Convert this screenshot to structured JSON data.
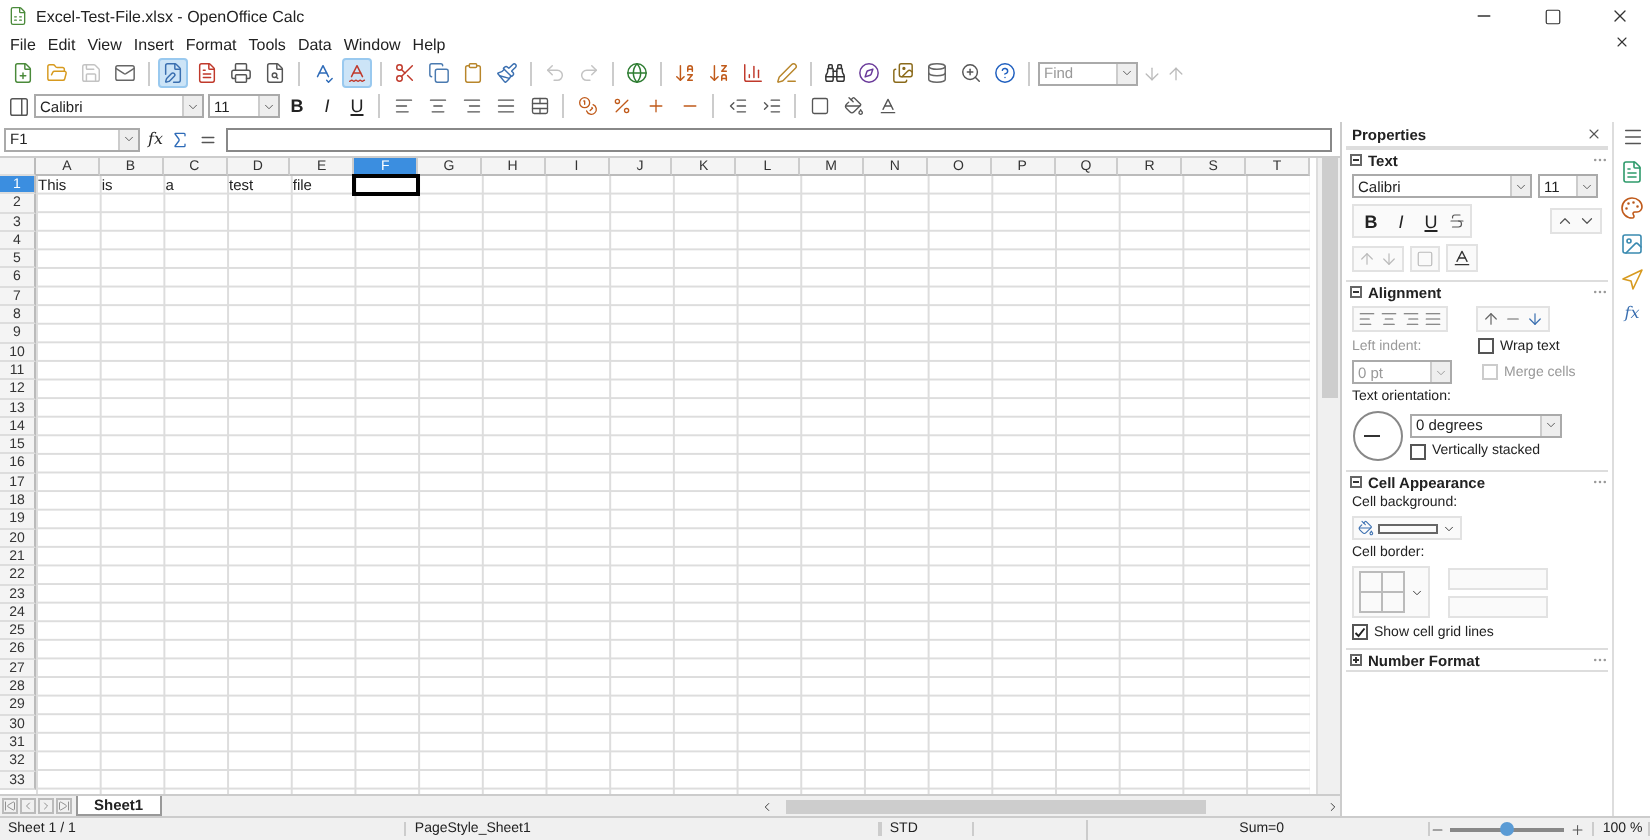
{
  "window": {
    "title": "Excel-Test-File.xlsx - OpenOffice Calc"
  },
  "menu": [
    {
      "label": "File"
    },
    {
      "label": "Edit"
    },
    {
      "label": "View"
    },
    {
      "label": "Insert"
    },
    {
      "label": "Format"
    },
    {
      "label": "Tools"
    },
    {
      "label": "Data"
    },
    {
      "label": "Window"
    },
    {
      "label": "Help"
    }
  ],
  "standard_toolbar": {
    "buttons": [
      {
        "active": false,
        "disabled": false
      },
      {
        "active": false,
        "disabled": false
      },
      {
        "active": false,
        "disabled": true
      },
      {
        "active": false,
        "disabled": false
      },
      {
        "active": true,
        "disabled": false
      },
      {
        "active": false,
        "disabled": false
      },
      {
        "active": false,
        "disabled": false
      },
      {
        "active": false,
        "disabled": false
      },
      {
        "active": false,
        "disabled": false
      },
      {
        "active": true,
        "disabled": false
      },
      {
        "active": false,
        "disabled": false
      },
      {
        "active": false,
        "disabled": false
      },
      {
        "active": false,
        "disabled": false
      },
      {
        "active": false,
        "disabled": false
      },
      {
        "active": false,
        "disabled": true
      },
      {
        "active": false,
        "disabled": true
      },
      {
        "active": false,
        "disabled": false
      },
      {
        "active": false,
        "disabled": false
      },
      {
        "active": false,
        "disabled": false
      },
      {
        "active": false,
        "disabled": false
      },
      {
        "active": false,
        "disabled": false
      },
      {
        "active": false,
        "disabled": false
      },
      {
        "active": false,
        "disabled": false
      },
      {
        "active": false,
        "disabled": false
      },
      {
        "active": false,
        "disabled": false
      },
      {
        "active": false,
        "disabled": false
      },
      {
        "active": false,
        "disabled": false
      }
    ],
    "find": {
      "placeholder": "Find"
    }
  },
  "formatting_toolbar": {
    "font_name": "Calibri",
    "font_size": "11",
    "style_buttons": [
      {
        "label": "B",
        "active": false
      },
      {
        "label": "I",
        "active": false
      },
      {
        "label": "U",
        "active": false
      }
    ]
  },
  "formula_bar": {
    "name_box": "F1",
    "function_wizard": "fx"
  },
  "sheet": {
    "columns": [
      {
        "label": "A",
        "selected": false
      },
      {
        "label": "B",
        "selected": false
      },
      {
        "label": "C",
        "selected": false
      },
      {
        "label": "D",
        "selected": false
      },
      {
        "label": "E",
        "selected": false
      },
      {
        "label": "F",
        "selected": true
      },
      {
        "label": "G",
        "selected": false
      },
      {
        "label": "H",
        "selected": false
      },
      {
        "label": "I",
        "selected": false
      },
      {
        "label": "J",
        "selected": false
      },
      {
        "label": "K",
        "selected": false
      },
      {
        "label": "L",
        "selected": false
      },
      {
        "label": "M",
        "selected": false
      },
      {
        "label": "N",
        "selected": false
      },
      {
        "label": "O",
        "selected": false
      },
      {
        "label": "P",
        "selected": false
      },
      {
        "label": "Q",
        "selected": false
      },
      {
        "label": "R",
        "selected": false
      },
      {
        "label": "S",
        "selected": false
      },
      {
        "label": "T",
        "selected": false
      }
    ],
    "rows": [
      {
        "label": "1",
        "selected": true,
        "cells": [
          "This",
          "is",
          "a",
          "test",
          "file"
        ]
      },
      {
        "label": "2",
        "selected": false
      },
      {
        "label": "3",
        "selected": false
      },
      {
        "label": "4",
        "selected": false
      },
      {
        "label": "5",
        "selected": false
      },
      {
        "label": "6",
        "selected": false
      },
      {
        "label": "7",
        "selected": false
      },
      {
        "label": "8",
        "selected": false
      },
      {
        "label": "9",
        "selected": false
      },
      {
        "label": "10",
        "selected": false
      },
      {
        "label": "11",
        "selected": false
      },
      {
        "label": "12",
        "selected": false
      },
      {
        "label": "13",
        "selected": false
      },
      {
        "label": "14",
        "selected": false
      },
      {
        "label": "15",
        "selected": false
      },
      {
        "label": "16",
        "selected": false
      },
      {
        "label": "17",
        "selected": false
      },
      {
        "label": "18",
        "selected": false
      },
      {
        "label": "19",
        "selected": false
      },
      {
        "label": "20",
        "selected": false
      },
      {
        "label": "21",
        "selected": false
      },
      {
        "label": "22",
        "selected": false
      },
      {
        "label": "23",
        "selected": false
      },
      {
        "label": "24",
        "selected": false
      },
      {
        "label": "25",
        "selected": false
      },
      {
        "label": "26",
        "selected": false
      },
      {
        "label": "27",
        "selected": false
      },
      {
        "label": "28",
        "selected": false
      },
      {
        "label": "29",
        "selected": false
      },
      {
        "label": "30",
        "selected": false
      },
      {
        "label": "31",
        "selected": false
      },
      {
        "label": "32",
        "selected": false
      },
      {
        "label": "33",
        "selected": false
      }
    ]
  },
  "sheet_tabs": [
    {
      "label": "Sheet1",
      "selected": true
    }
  ],
  "sidebar": {
    "title": "Properties",
    "functions_tab": "fx",
    "sections": [
      {
        "kind": "text",
        "title": "Text",
        "expanded": true,
        "font_name": "Calibri",
        "font_size": "11",
        "bold": "B",
        "italic": "I",
        "underline": "U"
      },
      {
        "kind": "alignment",
        "title": "Alignment",
        "expanded": true,
        "left_indent_label": "Left indent:",
        "left_indent": "0 pt",
        "wrap_text": {
          "label": "Wrap text",
          "checked": false,
          "disabled": false
        },
        "merge_cells": {
          "label": "Merge cells",
          "checked": false,
          "disabled": true
        },
        "orientation_label": "Text orientation:",
        "orientation": "0 degrees",
        "vertically_stacked": {
          "label": "Vertically stacked",
          "checked": false,
          "disabled": false
        }
      },
      {
        "kind": "appearance",
        "title": "Cell Appearance",
        "expanded": true,
        "background_label": "Cell background:",
        "border_label": "Cell border:",
        "grid_lines": {
          "label": "Show cell grid lines",
          "checked": true,
          "disabled": false
        }
      },
      {
        "kind": "number",
        "title": "Number Format",
        "expanded": false
      }
    ]
  },
  "status_bar": {
    "sheet": "Sheet 1 / 1",
    "page_style": "PageStyle_Sheet1",
    "mode": "STD",
    "sum": "Sum=0",
    "zoom": {
      "level": 0.5
    },
    "zoom_reading": "100 %"
  }
}
